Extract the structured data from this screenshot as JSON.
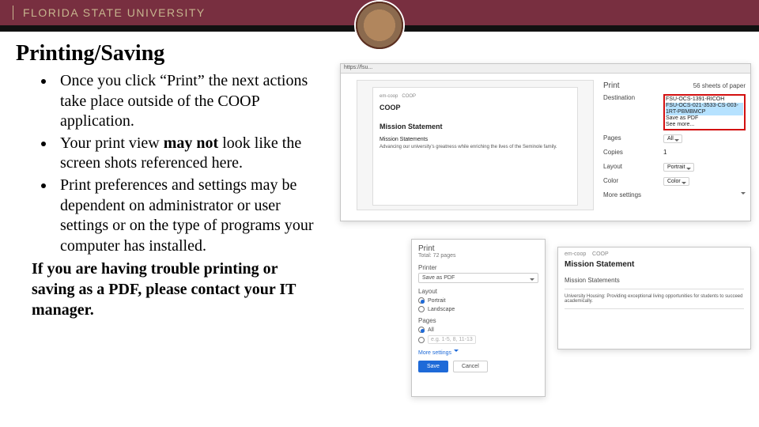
{
  "banner": {
    "text": "FLORIDA STATE UNIVERSITY"
  },
  "title": "Printing/Saving",
  "bullets": [
    {
      "pre": "Once you click “Print” the next actions take place outside of the COOP application."
    },
    {
      "pre": "Your print view ",
      "bold": "may not",
      "post": " look like the screen shots referenced here."
    },
    {
      "pre": "Print preferences and settings may be dependent on administrator or user settings or on the type of programs your computer has installed."
    }
  ],
  "trailer": "If you are having trouble printing or saving as a PDF, please contact your IT manager.",
  "chrome": {
    "url": "https://fsu...",
    "title": "Print",
    "sheets": "56 sheets of paper",
    "breadcrumb_left": "em-coop",
    "breadcrumb_right": "COOP",
    "app_title": "COOP",
    "section": "Mission Statement",
    "sub": "Mission Statements",
    "body": "Advancing our university’s greatness while enriching the lives of the Seminole family.",
    "labels": {
      "destination": "Destination",
      "pages": "Pages",
      "copies": "Copies",
      "layout": "Layout",
      "color": "Color",
      "more": "More settings"
    },
    "values": {
      "pages": "All",
      "copies": "1",
      "layout": "Portrait",
      "color": "Color"
    },
    "dest_options": [
      "FSU-OCS-1391-RICOH",
      "FSU-OCS-021-3533-CS-003-1RT-PBMBMCP",
      "Save as PDF",
      "See more..."
    ]
  },
  "ff": {
    "title": "Print",
    "count": "Total: 72 pages",
    "printer_label": "Printer",
    "printer_value": "Save as PDF",
    "layout_label": "Layout",
    "layout_portrait": "Portrait",
    "layout_landscape": "Landscape",
    "pages_label": "Pages",
    "pages_all": "All",
    "pages_custom": "e.g. 1-5, 8, 11-13",
    "more": "More settings",
    "save": "Save",
    "cancel": "Cancel"
  },
  "doc": {
    "crumb_left": "em-coop",
    "crumb_right": "COOP",
    "title": "Mission Statement",
    "sub": "Mission Statements",
    "line": "University Housing: Providing exceptional living opportunities for students to succeed academically."
  }
}
